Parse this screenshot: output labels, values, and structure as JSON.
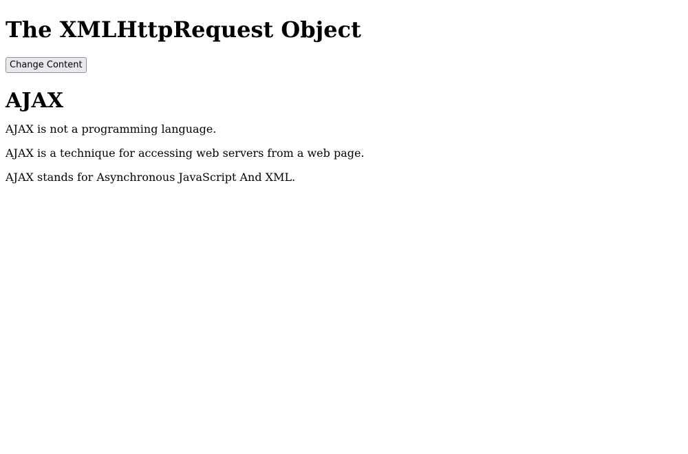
{
  "page": {
    "heading": "The XMLHttpRequest Object"
  },
  "controls": {
    "change_button_label": "Change Content"
  },
  "demo": {
    "heading": "AJAX",
    "paragraphs": [
      "AJAX is not a programming language.",
      "AJAX is a technique for accessing web servers from a web page.",
      "AJAX stands for Asynchronous JavaScript And XML."
    ]
  }
}
